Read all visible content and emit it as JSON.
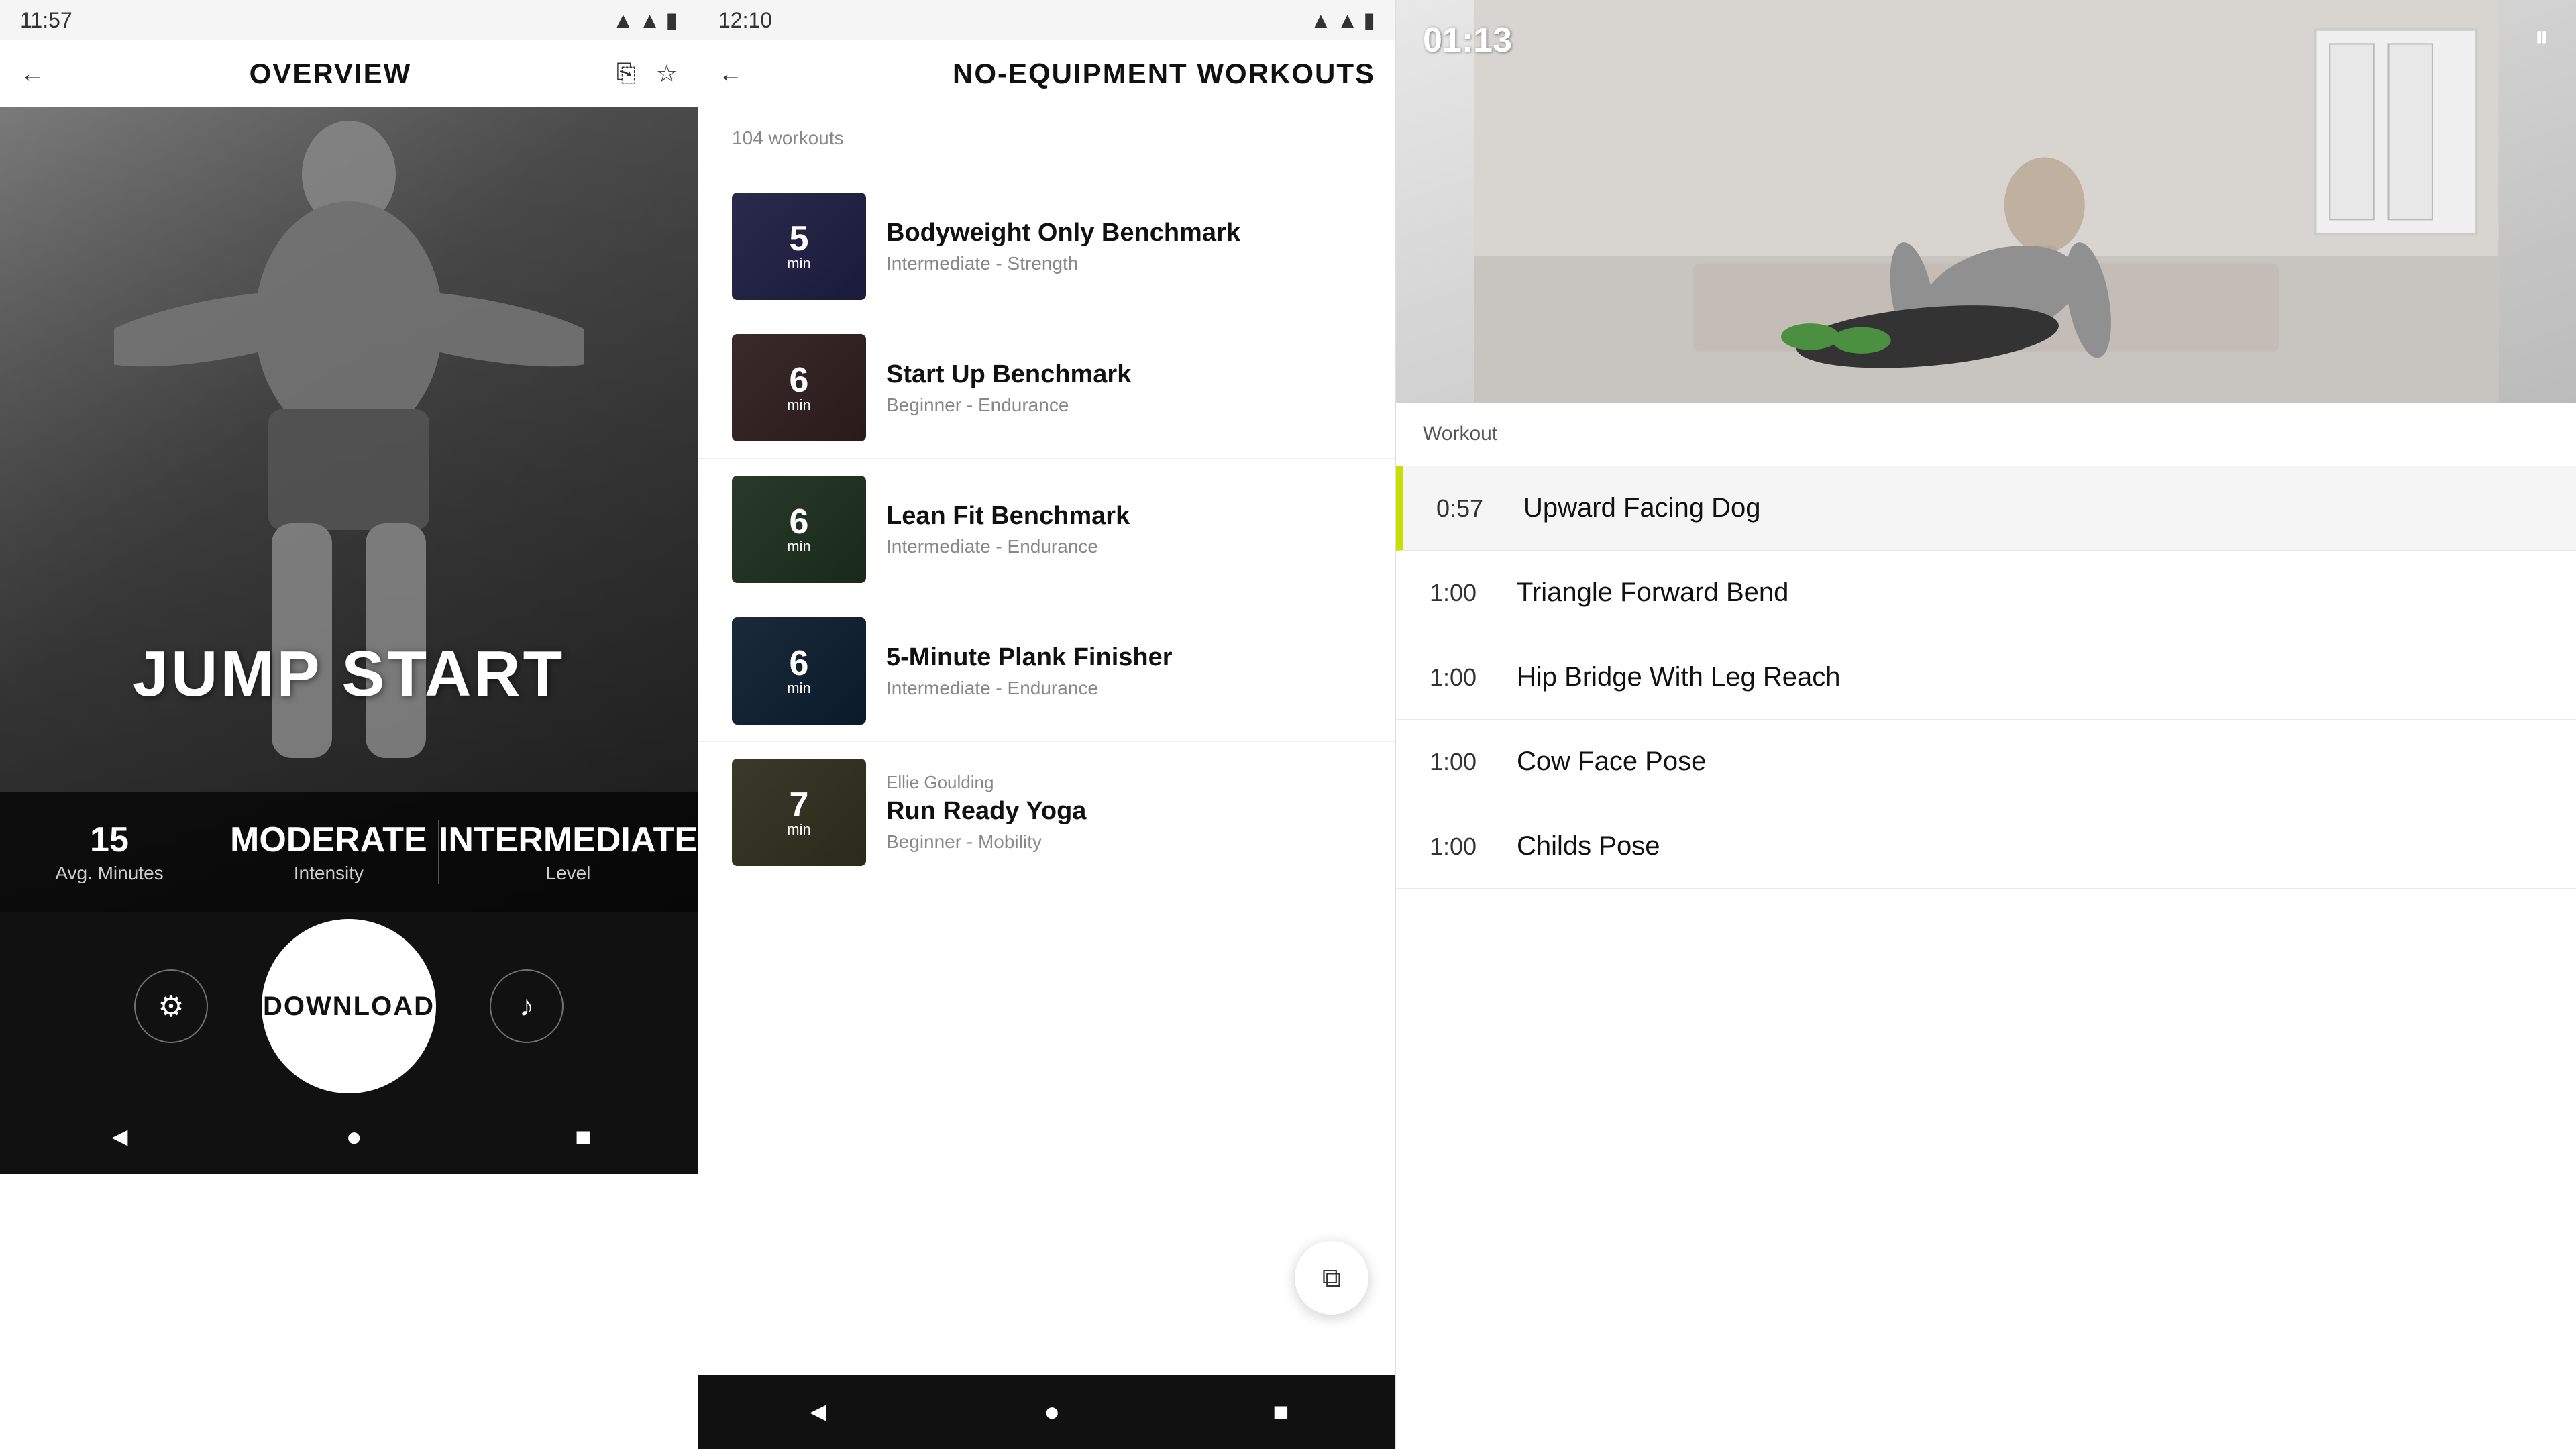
{
  "panel1": {
    "status_time": "11:57",
    "nav_title": "OVERVIEW",
    "hero_title": "JUMP START",
    "stat_minutes_value": "15",
    "stat_minutes_label": "Avg. Minutes",
    "stat_intensity_value": "MODERATE",
    "stat_intensity_label": "Intensity",
    "stat_level_value": "INTERMEDIATE",
    "stat_level_label": "Level",
    "download_label": "DOWNLOAD",
    "back_icon": "←",
    "share_icon": "⎘",
    "star_icon": "☆",
    "settings_icon": "⚙",
    "music_icon": "♪",
    "nav_back": "◄",
    "nav_home": "●",
    "nav_square": "■"
  },
  "panel2": {
    "status_time": "12:10",
    "nav_title": "NO-EQUIPMENT WORKOUTS",
    "workout_count": "104 workouts",
    "workouts": [
      {
        "name": "Bodyweight Only Benchmark",
        "meta": "Intermediate - Strength",
        "time_num": "5",
        "time_unit": "min",
        "thumb_class": "thumb-color-1",
        "artist": ""
      },
      {
        "name": "Start Up Benchmark",
        "meta": "Beginner - Endurance",
        "time_num": "6",
        "time_unit": "min",
        "thumb_class": "thumb-color-2",
        "artist": ""
      },
      {
        "name": "Lean Fit Benchmark",
        "meta": "Intermediate - Endurance",
        "time_num": "6",
        "time_unit": "min",
        "thumb_class": "thumb-color-3",
        "artist": ""
      },
      {
        "name": "5-Minute Plank Finisher",
        "meta": "Intermediate - Endurance",
        "time_num": "6",
        "time_unit": "min",
        "thumb_class": "thumb-color-4",
        "artist": ""
      },
      {
        "name": "Run Ready Yoga",
        "meta": "Beginner - Mobility",
        "time_num": "7",
        "time_unit": "min",
        "thumb_class": "thumb-color-5",
        "artist": "Ellie Goulding"
      }
    ],
    "nav_back": "◄",
    "nav_home": "●",
    "nav_square": "■",
    "filter_icon": "⧉"
  },
  "panel3": {
    "timer": "01:13",
    "pause_icon": "⏸",
    "section_label": "Workout",
    "exercises": [
      {
        "time": "0:57",
        "name": "Upward Facing Dog",
        "active": true
      },
      {
        "time": "1:00",
        "name": "Triangle Forward Bend",
        "active": false
      },
      {
        "time": "1:00",
        "name": "Hip Bridge With Leg Reach",
        "active": false
      },
      {
        "time": "1:00",
        "name": "Cow Face Pose",
        "active": false
      },
      {
        "time": "1:00",
        "name": "Childs Pose",
        "active": false
      }
    ]
  }
}
